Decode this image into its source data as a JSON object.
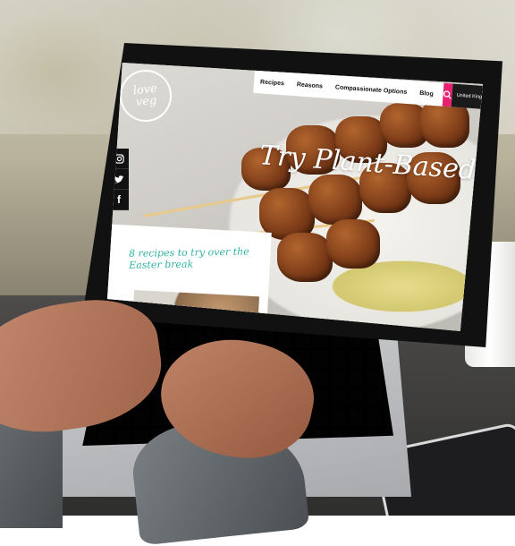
{
  "site": {
    "logo_text": "love veg",
    "headline": "Try Plant-Based!"
  },
  "nav": {
    "items": [
      {
        "label": "Recipes"
      },
      {
        "label": "Reasons"
      },
      {
        "label": "Compassionate Options"
      },
      {
        "label": "Blog"
      }
    ],
    "search_icon": "search-icon",
    "region_label": "United Kingdom",
    "region_icon": "chevron-down-icon"
  },
  "social": {
    "items": [
      {
        "icon": "instagram-icon",
        "glyph": "◎"
      },
      {
        "icon": "twitter-icon",
        "glyph": "🐦"
      },
      {
        "icon": "facebook-icon",
        "glyph": "f"
      }
    ]
  },
  "feature_card": {
    "title": "8 recipes to try over the Easter break"
  },
  "colors": {
    "accent_pink": "#e8216e",
    "accent_teal": "#34b3a7",
    "nav_dark": "#1a1a1a"
  }
}
